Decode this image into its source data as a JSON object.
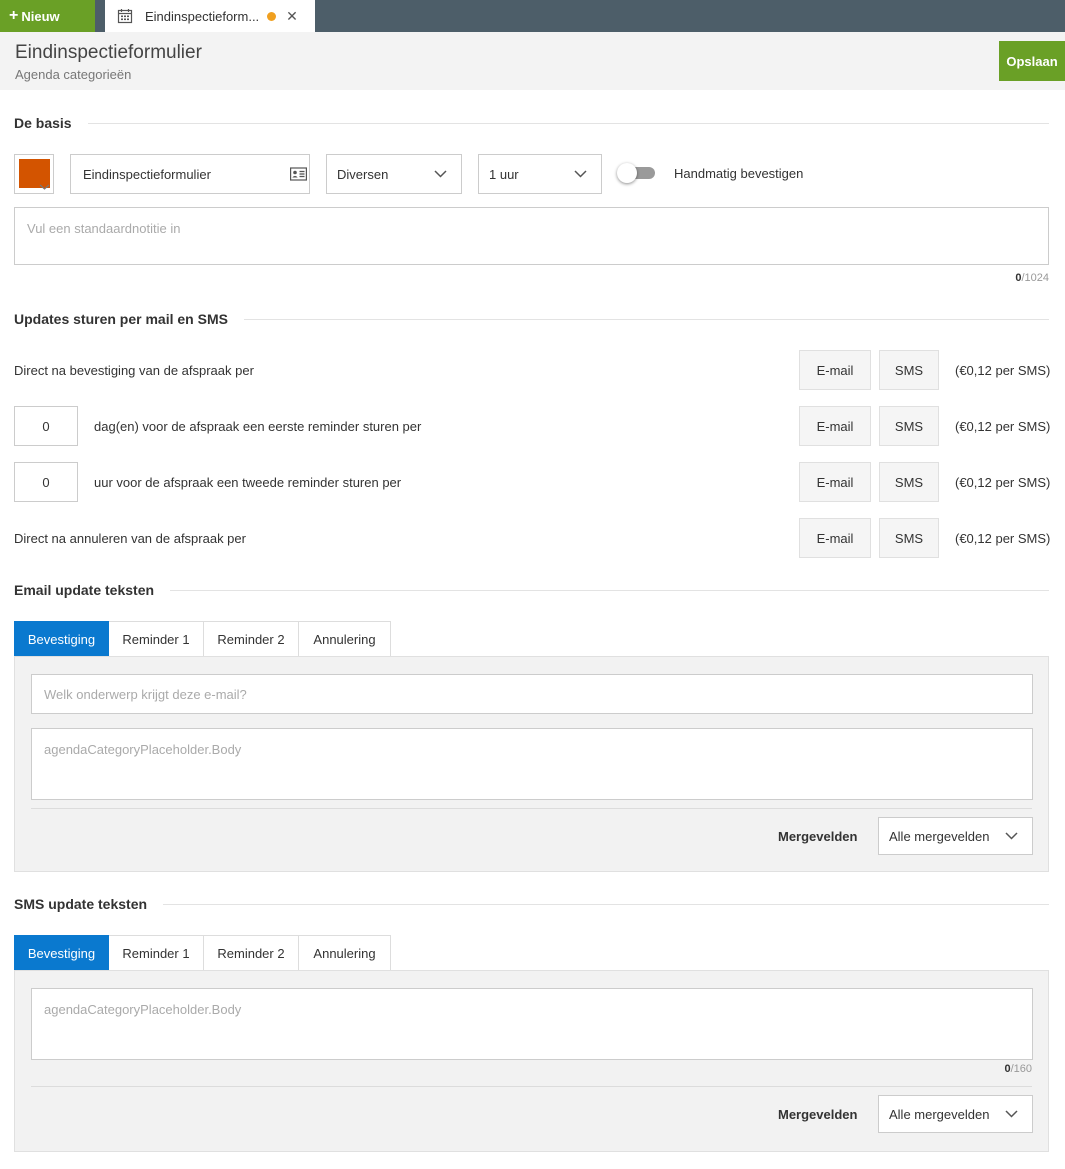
{
  "topbar": {
    "new_label": "Nieuw",
    "tab_label": "Eindinspectieform...",
    "tab_icon": "calendar-icon",
    "modified_color": "#f0a020"
  },
  "header": {
    "title": "Eindinspectieformulier",
    "subtitle": "Agenda categorieën",
    "save_label": "Opslaan"
  },
  "colors": {
    "accent_green": "#6aa026",
    "accent_blue": "#0a79cf",
    "category_color": "#d35400"
  },
  "basis": {
    "heading": "De basis",
    "name_value": "Eindinspectieformulier",
    "name_icon": "id-card-icon",
    "type_value": "Diversen",
    "duration_value": "1 uur",
    "toggle_label": "Handmatig bevestigen",
    "toggle_on": false,
    "note_placeholder": "Vul een standaardnotitie in",
    "note_count": "0",
    "note_max": "/1024"
  },
  "updates": {
    "heading": "Updates sturen per mail en SMS",
    "rows": [
      {
        "text": "Direct na bevestiging van de afspraak per",
        "email": "E-mail",
        "sms": "SMS",
        "price": "(€0,12 per SMS)"
      },
      {
        "value": "0",
        "text": "dag(en) voor de afspraak een eerste reminder sturen per",
        "email": "E-mail",
        "sms": "SMS",
        "price": "(€0,12 per SMS)"
      },
      {
        "value": "0",
        "text": "uur voor de afspraak een tweede reminder sturen per",
        "email": "E-mail",
        "sms": "SMS",
        "price": "(€0,12 per SMS)"
      },
      {
        "text": "Direct na annuleren van de afspraak per",
        "email": "E-mail",
        "sms": "SMS",
        "price": "(€0,12 per SMS)"
      }
    ]
  },
  "email_texts": {
    "heading": "Email update teksten",
    "tabs": [
      "Bevestiging",
      "Reminder 1",
      "Reminder 2",
      "Annulering"
    ],
    "active_tab": "Bevestiging",
    "subject_placeholder": "Welk onderwerp krijgt deze e-mail?",
    "body_placeholder": "agendaCategoryPlaceholder.Body",
    "merge_label": "Mergevelden",
    "merge_value": "Alle mergevelden"
  },
  "sms_texts": {
    "heading": "SMS update teksten",
    "tabs": [
      "Bevestiging",
      "Reminder 1",
      "Reminder 2",
      "Annulering"
    ],
    "active_tab": "Bevestiging",
    "body_placeholder": "agendaCategoryPlaceholder.Body",
    "body_count": "0",
    "body_max": "/160",
    "merge_label": "Mergevelden",
    "merge_value": "Alle mergevelden"
  }
}
